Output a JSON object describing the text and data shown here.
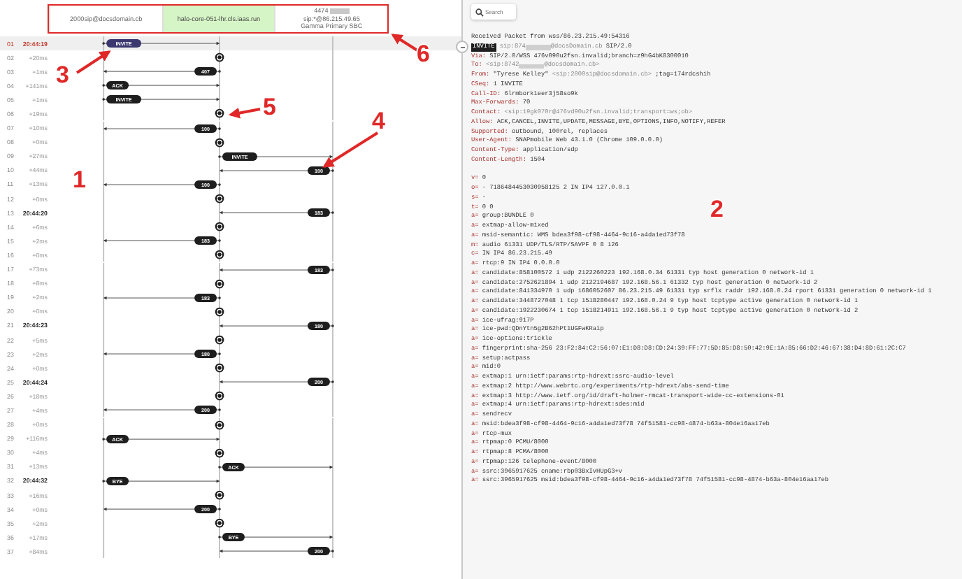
{
  "header": {
    "highlighted": true,
    "participants": [
      {
        "lines": [
          "2000sip@docsdomain.cb"
        ],
        "selected": false,
        "redacted": false
      },
      {
        "lines": [
          "halo-core-051-lhr.cls.iaas.run"
        ],
        "selected": true,
        "redacted": false
      },
      {
        "lines": [
          "4474",
          "sip:*@86.215.49.65",
          "Gamma Primary SBC"
        ],
        "selected": false,
        "redacted": true
      }
    ]
  },
  "rows": [
    {
      "num": "01",
      "time": "20:44:19",
      "absolute": true,
      "selected": true,
      "event": {
        "kind": "a_to_b",
        "label": "INVITE"
      }
    },
    {
      "num": "02",
      "time": "+20ms",
      "absolute": false,
      "selected": false,
      "event": {
        "kind": "process"
      }
    },
    {
      "num": "03",
      "time": "+1ms",
      "absolute": false,
      "selected": false,
      "event": {
        "kind": "b_to_a",
        "label": "407"
      }
    },
    {
      "num": "04",
      "time": "+141ms",
      "absolute": false,
      "selected": false,
      "event": {
        "kind": "a_to_b",
        "label": "ACK"
      }
    },
    {
      "num": "05",
      "time": "+1ms",
      "absolute": false,
      "selected": false,
      "event": {
        "kind": "a_to_b",
        "label": "INVITE"
      }
    },
    {
      "num": "06",
      "time": "+19ms",
      "absolute": false,
      "selected": false,
      "event": {
        "kind": "process"
      }
    },
    {
      "num": "07",
      "time": "+10ms",
      "absolute": false,
      "selected": false,
      "event": {
        "kind": "b_to_a",
        "label": "100"
      }
    },
    {
      "num": "08",
      "time": "+0ms",
      "absolute": false,
      "selected": false,
      "event": {
        "kind": "process"
      }
    },
    {
      "num": "09",
      "time": "+27ms",
      "absolute": false,
      "selected": false,
      "event": {
        "kind": "b_to_c",
        "label": "INVITE"
      }
    },
    {
      "num": "10",
      "time": "+44ms",
      "absolute": false,
      "selected": false,
      "event": {
        "kind": "c_to_b",
        "label": "100"
      }
    },
    {
      "num": "11",
      "time": "+13ms",
      "absolute": false,
      "selected": false,
      "event": {
        "kind": "b_to_a",
        "label": "100"
      }
    },
    {
      "num": "12",
      "time": "+0ms",
      "absolute": false,
      "selected": false,
      "event": {
        "kind": "process"
      }
    },
    {
      "num": "13",
      "time": "20:44:20",
      "absolute": true,
      "selected": false,
      "event": {
        "kind": "c_to_b",
        "label": "183"
      }
    },
    {
      "num": "14",
      "time": "+6ms",
      "absolute": false,
      "selected": false,
      "event": {
        "kind": "process"
      }
    },
    {
      "num": "15",
      "time": "+2ms",
      "absolute": false,
      "selected": false,
      "event": {
        "kind": "b_to_a",
        "label": "183"
      }
    },
    {
      "num": "16",
      "time": "+0ms",
      "absolute": false,
      "selected": false,
      "event": {
        "kind": "process"
      }
    },
    {
      "num": "17",
      "time": "+73ms",
      "absolute": false,
      "selected": false,
      "event": {
        "kind": "c_to_b",
        "label": "183"
      }
    },
    {
      "num": "18",
      "time": "+8ms",
      "absolute": false,
      "selected": false,
      "event": {
        "kind": "process"
      }
    },
    {
      "num": "19",
      "time": "+2ms",
      "absolute": false,
      "selected": false,
      "event": {
        "kind": "b_to_a",
        "label": "183"
      }
    },
    {
      "num": "20",
      "time": "+0ms",
      "absolute": false,
      "selected": false,
      "event": {
        "kind": "process"
      }
    },
    {
      "num": "21",
      "time": "20:44:23",
      "absolute": true,
      "selected": false,
      "event": {
        "kind": "c_to_b",
        "label": "180"
      }
    },
    {
      "num": "22",
      "time": "+5ms",
      "absolute": false,
      "selected": false,
      "event": {
        "kind": "process"
      }
    },
    {
      "num": "23",
      "time": "+2ms",
      "absolute": false,
      "selected": false,
      "event": {
        "kind": "b_to_a",
        "label": "180"
      }
    },
    {
      "num": "24",
      "time": "+0ms",
      "absolute": false,
      "selected": false,
      "event": {
        "kind": "process"
      }
    },
    {
      "num": "25",
      "time": "20:44:24",
      "absolute": true,
      "selected": false,
      "event": {
        "kind": "c_to_b",
        "label": "200"
      }
    },
    {
      "num": "26",
      "time": "+18ms",
      "absolute": false,
      "selected": false,
      "event": {
        "kind": "process"
      }
    },
    {
      "num": "27",
      "time": "+4ms",
      "absolute": false,
      "selected": false,
      "event": {
        "kind": "b_to_a",
        "label": "200"
      }
    },
    {
      "num": "28",
      "time": "+0ms",
      "absolute": false,
      "selected": false,
      "event": {
        "kind": "process"
      }
    },
    {
      "num": "29",
      "time": "+116ms",
      "absolute": false,
      "selected": false,
      "event": {
        "kind": "a_to_b",
        "label": "ACK"
      }
    },
    {
      "num": "30",
      "time": "+4ms",
      "absolute": false,
      "selected": false,
      "event": {
        "kind": "process"
      }
    },
    {
      "num": "31",
      "time": "+13ms",
      "absolute": false,
      "selected": false,
      "event": {
        "kind": "b_to_c",
        "label": "ACK"
      }
    },
    {
      "num": "32",
      "time": "20:44:32",
      "absolute": true,
      "selected": false,
      "event": {
        "kind": "a_to_b",
        "label": "BYE"
      }
    },
    {
      "num": "33",
      "time": "+16ms",
      "absolute": false,
      "selected": false,
      "event": {
        "kind": "process"
      }
    },
    {
      "num": "34",
      "time": "+0ms",
      "absolute": false,
      "selected": false,
      "event": {
        "kind": "b_to_a",
        "label": "200"
      }
    },
    {
      "num": "35",
      "time": "+2ms",
      "absolute": false,
      "selected": false,
      "event": {
        "kind": "process"
      }
    },
    {
      "num": "36",
      "time": "+17ms",
      "absolute": false,
      "selected": false,
      "event": {
        "kind": "b_to_c",
        "label": "BYE"
      }
    },
    {
      "num": "37",
      "time": "+84ms",
      "absolute": false,
      "selected": false,
      "event": {
        "kind": "c_to_b",
        "label": "200"
      }
    }
  ],
  "search": {
    "placeholder": "Search"
  },
  "packet": [
    {
      "value": "Received Packet from wss/86.23.215.49:54316"
    },
    {
      "method": "INVITE",
      "parts": [
        {
          "kind": "uri",
          "text": "sip:874"
        },
        {
          "kind": "redacted"
        },
        {
          "kind": "uri",
          "text": "@docsDomain.cb"
        },
        {
          "kind": "text",
          "text": "SIP/2.0"
        }
      ]
    },
    {
      "key": "Via:",
      "value": "SIP/2.0/WSS 476v090u2fsn.invalid;branch=z9hG4bK8300010"
    },
    {
      "key": "To:",
      "parts": [
        {
          "kind": "uri",
          "text": "<sip:8742"
        },
        {
          "kind": "redacted"
        },
        {
          "kind": "uri",
          "text": "@docsdomain.cb>"
        }
      ]
    },
    {
      "key": "From:",
      "parts": [
        {
          "kind": "text",
          "text": "\"Tyrese Kelley\""
        },
        {
          "kind": "uri",
          "text": "<sip:2000sip@docsdomain.cb>"
        },
        {
          "kind": "text",
          "text": ";tag=174rdcshih"
        }
      ]
    },
    {
      "key": "CSeq:",
      "value": "1 INVITE"
    },
    {
      "key": "Call-ID:",
      "value": "6lrmbork1eer3j58so9k"
    },
    {
      "key": "Max-Forwards:",
      "value": "70"
    },
    {
      "key": "Contact:",
      "parts": [
        {
          "kind": "uri",
          "text": "<sip:19gk070r@476vd90u2fsn.invalid;transport=ws;ob>"
        }
      ]
    },
    {
      "key": "Allow:",
      "value": "ACK,CANCEL,INVITE,UPDATE,MESSAGE,BYE,OPTIONS,INFO,NOTIFY,REFER"
    },
    {
      "key": "Supported:",
      "value": "outbound, 100rel, replaces"
    },
    {
      "key": "User-Agent:",
      "value": "SNAPmobile Web 43.1.0 (Chrome 109.0.0.0)"
    },
    {
      "key": "Content-Type:",
      "value": "application/sdp"
    },
    {
      "key": "Content-Length:",
      "value": "1504"
    },
    {
      "key": "v=",
      "value": "0",
      "gap_before": true
    },
    {
      "key": "o=",
      "value": "- 7186484453030958125 2 IN IP4 127.0.0.1"
    },
    {
      "key": "s=",
      "value": "-"
    },
    {
      "key": "t=",
      "value": "0 0"
    },
    {
      "key": "a=",
      "value": "group:BUNDLE 0"
    },
    {
      "key": "a=",
      "value": "extmap-allow-mixed"
    },
    {
      "key": "a=",
      "value": "msid-semantic: WMS bdea3f98-cf98-4464-9c16-a4da1ed73f78"
    },
    {
      "key": "m=",
      "value": "audio 61331 UDP/TLS/RTP/SAVPF 0 8 126"
    },
    {
      "key": "c=",
      "value": "IN IP4 86.23.215.49"
    },
    {
      "key": "a=",
      "value": "rtcp:9 IN IP4 0.0.0.0"
    },
    {
      "key": "a=",
      "value": "candidate:858100572 1 udp 2122260223 192.168.0.34 61331 typ host generation 0 network-id 1"
    },
    {
      "key": "a=",
      "value": "candidate:2752621894 1 udp 2122194687 192.168.56.1 61332 typ host generation 0 network-id 2"
    },
    {
      "key": "a=",
      "value": "candidate:841334970 1 udp 1686052607 86.23.215.49 61331 typ srflx raddr 192.168.0.24 rport 61331 generation 0 network-id 1"
    },
    {
      "key": "a=",
      "value": "candidate:3448727048 1 tcp 1518280447 192.168.0.24 9 typ host tcptype active generation 0 network-id 1"
    },
    {
      "key": "a=",
      "value": "candidate:1922230674 1 tcp 1518214911 192.168.56.1 9 typ host tcptype active generation 0 network-id 2"
    },
    {
      "key": "a=",
      "value": "ice-ufrag:917P"
    },
    {
      "key": "a=",
      "value": "ice-pwd:QDnYtn5g2B62hPt1UGFwKRaip"
    },
    {
      "key": "a=",
      "value": "ice-options:trickle"
    },
    {
      "key": "a=",
      "value": "fingerprint:sha-256 23:F2:84:C2:56:07:E1:D8:D8:CD:24:39:FF:77:5D:85:D8:50:42:9E:1A:85:66:D2:46:67:38:D4:8D:61:2C:C7"
    },
    {
      "key": "a=",
      "value": "setup:actpass"
    },
    {
      "key": "a=",
      "value": "mid:0"
    },
    {
      "key": "a=",
      "value": "extmap:1 urn:ietf:params:rtp-hdrext:ssrc-audio-level"
    },
    {
      "key": "a=",
      "value": "extmap:2 http://www.webrtc.org/experiments/rtp-hdrext/abs-send-time"
    },
    {
      "key": "a=",
      "value": "extmap:3 http://www.ietf.org/id/draft-holmer-rmcat-transport-wide-cc-extensions-01"
    },
    {
      "key": "a=",
      "value": "extmap:4 urn:ietf:params:rtp-hdrext:sdes:mid"
    },
    {
      "key": "a=",
      "value": "sendrecv"
    },
    {
      "key": "a=",
      "value": "msid:bdea3f98-cf98-4464-9c16-a4da1ed73f78 74f51581-cc98-4874-b63a-804e16aa17eb"
    },
    {
      "key": "a=",
      "value": "rtcp-mux"
    },
    {
      "key": "a=",
      "value": "rtpmap:0 PCMU/8000"
    },
    {
      "key": "a=",
      "value": "rtpmap:8 PCMA/8000"
    },
    {
      "key": "a=",
      "value": "rtpmap:126 telephone-event/8000"
    },
    {
      "key": "a=",
      "value": "ssrc:3965917625 cname:rbp03BxIvHUpG3+v"
    },
    {
      "key": "a=",
      "value": "ssrc:3965917625 msid:bdea3f98-cf98-4464-9c16-a4da1ed73f78 74f51581-cc98-4874-b63a-804e16aa17eb"
    }
  ],
  "annotations": [
    {
      "label": "1",
      "arrow": false
    },
    {
      "label": "2",
      "arrow": false
    },
    {
      "label": "3",
      "arrow": true
    },
    {
      "label": "4",
      "arrow": true
    },
    {
      "label": "5",
      "arrow": true
    },
    {
      "label": "6",
      "arrow": true
    }
  ]
}
